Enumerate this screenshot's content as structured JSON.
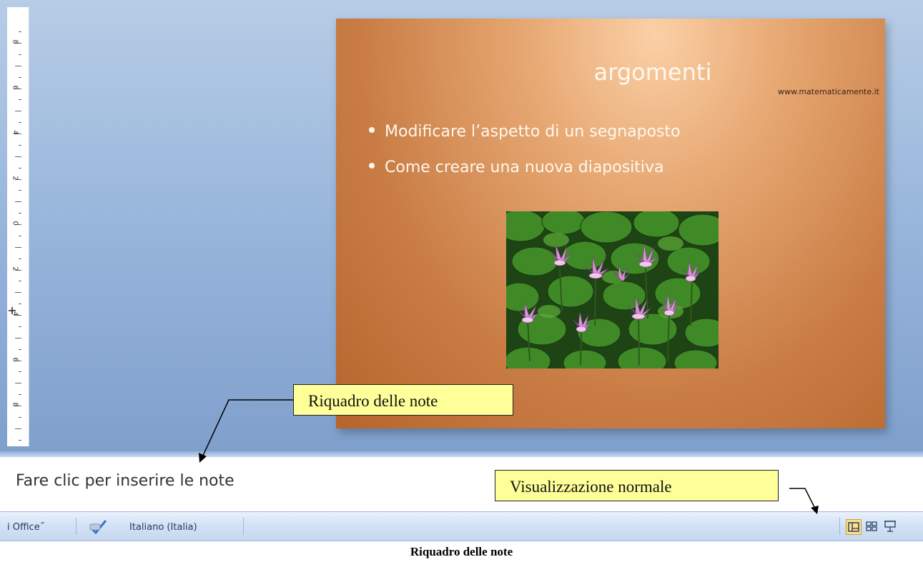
{
  "slide": {
    "title": "argomenti",
    "url": "www.matematicamente.it",
    "bullets": [
      "Modificare l’aspetto di un segnaposto",
      "Come creare una nuova diapositiva"
    ],
    "image_icon": "water-lily-photo"
  },
  "ruler": {
    "labels": [
      "8",
      "6",
      "4",
      "2",
      "0",
      "2",
      "4",
      "6",
      "8"
    ]
  },
  "notes": {
    "placeholder": "Fare clic per inserire le note"
  },
  "callouts": {
    "notes_pane": "Riquadro delle note",
    "normal_view": "Visualizzazione normale"
  },
  "status_bar": {
    "office_text": "i Office˝",
    "language": "Italiano (Italia)",
    "spellcheck_icon": "proofing-check-icon",
    "view_buttons": [
      "normal-view-icon",
      "slide-sorter-view-icon",
      "slideshow-view-icon"
    ]
  },
  "caption": "Riquadro delle note",
  "colors": {
    "workspace": "#9ab7dc",
    "slide_bg": "#c97d45",
    "callout": "#ffff99",
    "statusbar": "#d2e1f5"
  }
}
